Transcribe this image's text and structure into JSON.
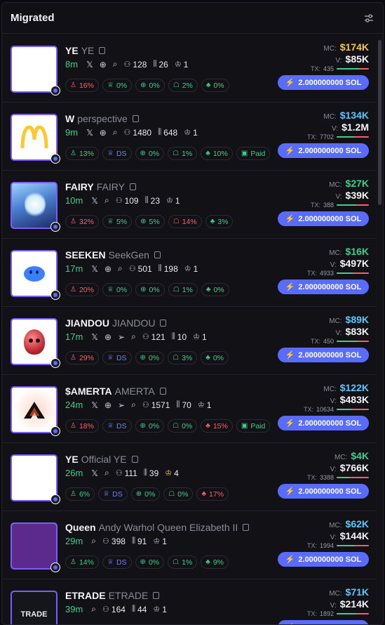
{
  "header": {
    "title": "Migrated",
    "filter_icon": "sliders-icon"
  },
  "colors": {
    "accent": "#5a6cff",
    "green": "#3ecf8e",
    "red": "#ff5c6c",
    "gold": "#f3c64b",
    "blue": "#6c80ff"
  },
  "buy_label": "2.000000000 SOL",
  "tokens": [
    {
      "symbol": "YE",
      "name": "YE",
      "age": "8m",
      "socials": [
        "x",
        "web",
        "search"
      ],
      "holders": "128",
      "txs": "26",
      "crown": "1",
      "crown_gold": false,
      "badges": [
        {
          "icon": "user",
          "val": "16%",
          "c": "red"
        },
        {
          "icon": "chef",
          "val": "0%",
          "c": "green"
        },
        {
          "icon": "target",
          "val": "0%",
          "c": "green"
        },
        {
          "icon": "ghost",
          "val": "2%",
          "c": "green"
        },
        {
          "icon": "clover",
          "val": "0%",
          "c": "green"
        }
      ],
      "mc": "$174K",
      "mc_color": "#f3c64b",
      "v": "$85K",
      "tx": "435",
      "buy_ratio": 0.7,
      "avatar": "blank"
    },
    {
      "symbol": "W",
      "name": "perspective",
      "age": "9m",
      "socials": [
        "x",
        "web",
        "search"
      ],
      "holders": "1480",
      "txs": "648",
      "crown": "1",
      "crown_gold": false,
      "badges": [
        {
          "icon": "user",
          "val": "13%",
          "c": "green"
        },
        {
          "icon": "chef",
          "val": "DS",
          "c": "blue"
        },
        {
          "icon": "target",
          "val": "0%",
          "c": "green"
        },
        {
          "icon": "ghost",
          "val": "1%",
          "c": "green"
        },
        {
          "icon": "clover",
          "val": "10%",
          "c": "green"
        },
        {
          "icon": "paid",
          "val": "Paid",
          "c": "green"
        }
      ],
      "mc": "$134K",
      "mc_color": "#5cc8ff",
      "v": "$1.2M",
      "tx": "7702",
      "buy_ratio": 0.55,
      "avatar": "mcd"
    },
    {
      "symbol": "FAIRY",
      "name": "FAIRY",
      "age": "10m",
      "socials": [
        "x",
        "search"
      ],
      "holders": "109",
      "txs": "23",
      "crown": "1",
      "crown_gold": false,
      "badges": [
        {
          "icon": "user",
          "val": "32%",
          "c": "red"
        },
        {
          "icon": "chef",
          "val": "5%",
          "c": "green"
        },
        {
          "icon": "target",
          "val": "5%",
          "c": "green"
        },
        {
          "icon": "ghost",
          "val": "14%",
          "c": "red"
        },
        {
          "icon": "clover",
          "val": "3%",
          "c": "green"
        }
      ],
      "mc": "$27K",
      "mc_color": "#3ecf8e",
      "v": "$39K",
      "tx": "388",
      "buy_ratio": 0.6,
      "avatar": "fairy"
    },
    {
      "symbol": "SEEKEN",
      "name": "SeekGen",
      "age": "17m",
      "socials": [
        "x",
        "web",
        "search"
      ],
      "holders": "501",
      "txs": "198",
      "crown": "1",
      "crown_gold": false,
      "badges": [
        {
          "icon": "user",
          "val": "20%",
          "c": "red"
        },
        {
          "icon": "chef",
          "val": "0%",
          "c": "green"
        },
        {
          "icon": "target",
          "val": "0%",
          "c": "green"
        },
        {
          "icon": "ghost",
          "val": "1%",
          "c": "green"
        },
        {
          "icon": "clover",
          "val": "0%",
          "c": "green"
        }
      ],
      "mc": "$16K",
      "mc_color": "#3ecf8e",
      "v": "$497K",
      "tx": "4933",
      "buy_ratio": 0.5,
      "avatar": "blob"
    },
    {
      "symbol": "JIANDOU",
      "name": "JIANDOU",
      "age": "17m",
      "socials": [
        "x",
        "web",
        "telegram",
        "search"
      ],
      "holders": "121",
      "txs": "10",
      "crown": "1",
      "crown_gold": false,
      "badges": [
        {
          "icon": "user",
          "val": "29%",
          "c": "red"
        },
        {
          "icon": "chef",
          "val": "DS",
          "c": "blue"
        },
        {
          "icon": "target",
          "val": "0%",
          "c": "green"
        },
        {
          "icon": "ghost",
          "val": "3%",
          "c": "green"
        },
        {
          "icon": "clover",
          "val": "0%",
          "c": "green"
        }
      ],
      "mc": "$89K",
      "mc_color": "#5cc8ff",
      "v": "$83K",
      "tx": "450",
      "buy_ratio": 0.65,
      "avatar": "head"
    },
    {
      "symbol": "$AMERTA",
      "name": "AMERTA",
      "age": "24m",
      "socials": [
        "x",
        "web",
        "telegram",
        "search"
      ],
      "holders": "1571",
      "txs": "70",
      "crown": "1",
      "crown_gold": false,
      "badges": [
        {
          "icon": "user",
          "val": "18%",
          "c": "red"
        },
        {
          "icon": "chef",
          "val": "DS",
          "c": "blue"
        },
        {
          "icon": "target",
          "val": "0%",
          "c": "green"
        },
        {
          "icon": "ghost",
          "val": "0%",
          "c": "green"
        },
        {
          "icon": "clover",
          "val": "15%",
          "c": "red"
        },
        {
          "icon": "paid",
          "val": "Paid",
          "c": "green"
        }
      ],
      "mc": "$122K",
      "mc_color": "#5cc8ff",
      "v": "$483K",
      "tx": "10634",
      "buy_ratio": 0.45,
      "avatar": "amerta"
    },
    {
      "symbol": "YE",
      "name": "Official YE",
      "age": "26m",
      "socials": [
        "x",
        "search"
      ],
      "holders": "111",
      "txs": "39",
      "crown": "4",
      "crown_gold": true,
      "badges": [
        {
          "icon": "user",
          "val": "6%",
          "c": "green"
        },
        {
          "icon": "chef",
          "val": "DS",
          "c": "blue"
        },
        {
          "icon": "target",
          "val": "0%",
          "c": "green"
        },
        {
          "icon": "ghost",
          "val": "0%",
          "c": "green"
        },
        {
          "icon": "clover",
          "val": "17%",
          "c": "red"
        }
      ],
      "mc": "$4K",
      "mc_color": "#3ecf8e",
      "v": "$766K",
      "tx": "3388",
      "buy_ratio": 0.4,
      "avatar": "blank"
    },
    {
      "symbol": "Queen",
      "name": "Andy Warhol Queen Elizabeth II",
      "age": "29m",
      "socials": [
        "search"
      ],
      "holders": "398",
      "txs": "91",
      "crown": "1",
      "crown_gold": false,
      "badges": [
        {
          "icon": "user",
          "val": "14%",
          "c": "green"
        },
        {
          "icon": "chef",
          "val": "DS",
          "c": "blue"
        },
        {
          "icon": "target",
          "val": "0%",
          "c": "green"
        },
        {
          "icon": "ghost",
          "val": "1%",
          "c": "green"
        },
        {
          "icon": "clover",
          "val": "9%",
          "c": "green"
        }
      ],
      "mc": "$62K",
      "mc_color": "#5cc8ff",
      "v": "$144K",
      "tx": "1994",
      "buy_ratio": 0.55,
      "avatar": "purple"
    },
    {
      "symbol": "ETRADE",
      "name": "ETRADE",
      "age": "39m",
      "socials": [
        "search"
      ],
      "holders": "164",
      "txs": "44",
      "crown": "1",
      "crown_gold": false,
      "badges": [],
      "mc": "$71K",
      "mc_color": "#5cc8ff",
      "v": "$214K",
      "tx": "1892",
      "buy_ratio": 0.6,
      "avatar": "etrade",
      "avatar_text": "TRADE"
    }
  ]
}
